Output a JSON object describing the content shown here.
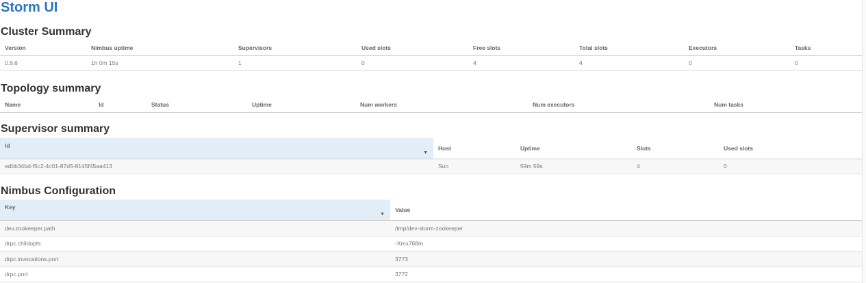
{
  "app": {
    "title": "Storm UI"
  },
  "cluster": {
    "heading": "Cluster Summary",
    "columns": [
      "Version",
      "Nimbus uptime",
      "Supervisors",
      "Used slots",
      "Free slots",
      "Total slots",
      "Executors",
      "Tasks"
    ],
    "rows": [
      [
        "0.9.6",
        "1h 0m 15s",
        "1",
        "0",
        "4",
        "4",
        "0",
        "0"
      ]
    ]
  },
  "topology": {
    "heading": "Topology summary",
    "columns": [
      "Name",
      "Id",
      "Status",
      "Uptime",
      "Num workers",
      "Num executors",
      "Num tasks"
    ]
  },
  "supervisor": {
    "heading": "Supervisor summary",
    "columns": [
      "Id",
      "Host",
      "Uptime",
      "Slots",
      "Used slots"
    ],
    "sorted_column": "Id",
    "rows": [
      [
        "edbb34bd-f5c2-4c01-87d5-8145f45aa413",
        "Sun",
        "59m 59s",
        "4",
        "0"
      ]
    ]
  },
  "nimbus": {
    "heading": "Nimbus Configuration",
    "columns": [
      "Key",
      "Value"
    ],
    "sorted_column": "Key",
    "rows": [
      [
        "dev.zookeeper.path",
        "/tmp/dev-storm-zookeeper"
      ],
      [
        "drpc.childopts",
        "-Xmx768m"
      ],
      [
        "drpc.invocations.port",
        "3773"
      ],
      [
        "drpc.port",
        "3772"
      ]
    ]
  },
  "icons": {
    "sort": "sort-descending-caret-icon"
  },
  "colors": {
    "title": "#2a75c4",
    "sorted_header": "#e1eef7",
    "stripe": "#f7f7f7"
  }
}
